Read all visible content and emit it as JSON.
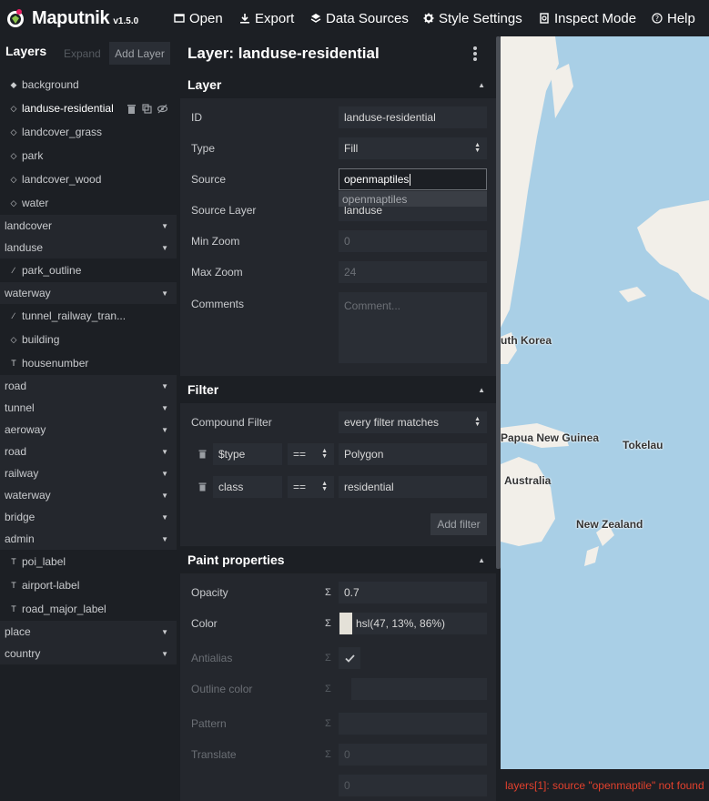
{
  "app": {
    "name": "Maputnik",
    "version": "v1.5.0"
  },
  "menu": [
    {
      "label": "Open",
      "icon": "folder-open-icon"
    },
    {
      "label": "Export",
      "icon": "download-icon"
    },
    {
      "label": "Data Sources",
      "icon": "layers-stack-icon"
    },
    {
      "label": "Style Settings",
      "icon": "gear-icon"
    },
    {
      "label": "Inspect Mode",
      "icon": "inspect-icon"
    },
    {
      "label": "Help",
      "icon": "help-circle-icon"
    }
  ],
  "layer_panel": {
    "title": "Layers",
    "expand_label": "Expand",
    "add_layer_label": "Add Layer",
    "items": [
      {
        "kind": "layer",
        "label": "background",
        "icon": "background-layer-icon"
      },
      {
        "kind": "layer",
        "label": "landuse-residential",
        "icon": "fill-layer-icon",
        "selected": true
      },
      {
        "kind": "layer",
        "label": "landcover_grass",
        "icon": "fill-layer-icon"
      },
      {
        "kind": "layer",
        "label": "park",
        "icon": "fill-layer-icon"
      },
      {
        "kind": "layer",
        "label": "landcover_wood",
        "icon": "fill-layer-icon"
      },
      {
        "kind": "layer",
        "label": "water",
        "icon": "fill-layer-icon"
      },
      {
        "kind": "group",
        "label": "landcover"
      },
      {
        "kind": "group",
        "label": "landuse"
      },
      {
        "kind": "layer",
        "label": "park_outline",
        "icon": "line-layer-icon"
      },
      {
        "kind": "group",
        "label": "waterway"
      },
      {
        "kind": "layer",
        "label": "tunnel_railway_tran...",
        "icon": "line-layer-icon"
      },
      {
        "kind": "layer",
        "label": "building",
        "icon": "fill-layer-icon"
      },
      {
        "kind": "layer",
        "label": "housenumber",
        "icon": "symbol-layer-icon"
      },
      {
        "kind": "group",
        "label": "road"
      },
      {
        "kind": "group",
        "label": "tunnel"
      },
      {
        "kind": "group",
        "label": "aeroway"
      },
      {
        "kind": "group",
        "label": "road"
      },
      {
        "kind": "group",
        "label": "railway"
      },
      {
        "kind": "group",
        "label": "waterway"
      },
      {
        "kind": "group",
        "label": "bridge"
      },
      {
        "kind": "group",
        "label": "admin"
      },
      {
        "kind": "layer",
        "label": "poi_label",
        "icon": "symbol-layer-icon"
      },
      {
        "kind": "layer",
        "label": "airport-label",
        "icon": "symbol-layer-icon"
      },
      {
        "kind": "layer",
        "label": "road_major_label",
        "icon": "symbol-layer-icon"
      },
      {
        "kind": "group",
        "label": "place"
      },
      {
        "kind": "group",
        "label": "country"
      }
    ]
  },
  "editor": {
    "title": "Layer: landuse-residential",
    "layer_section": {
      "title": "Layer",
      "id_label": "ID",
      "id_value": "landuse-residential",
      "type_label": "Type",
      "type_value": "Fill",
      "source_label": "Source",
      "source_value": "openmaptiles",
      "source_suggestion": "openmaptiles",
      "source_layer_label": "Source Layer",
      "source_layer_value": "landuse",
      "min_zoom_label": "Min Zoom",
      "min_zoom_placeholder": "0",
      "max_zoom_label": "Max Zoom",
      "max_zoom_placeholder": "24",
      "comments_label": "Comments",
      "comments_placeholder": "Comment..."
    },
    "filter_section": {
      "title": "Filter",
      "compound_label": "Compound Filter",
      "compound_value": "every filter matches",
      "rows": [
        {
          "key": "$type",
          "op": "==",
          "value": "Polygon"
        },
        {
          "key": "class",
          "op": "==",
          "value": "residential"
        }
      ],
      "add_filter_label": "Add filter"
    },
    "paint_section": {
      "title": "Paint properties",
      "opacity_label": "Opacity",
      "opacity_value": "0.7",
      "color_label": "Color",
      "color_value": "hsl(47, 13%, 86%)",
      "color_swatch": "#e4e1d8",
      "antialias_label": "Antialias",
      "outline_color_label": "Outline color",
      "pattern_label": "Pattern",
      "translate_label": "Translate",
      "translate_x_placeholder": "0",
      "translate_y_placeholder": "0",
      "sigma": "Σ"
    }
  },
  "map": {
    "labels": [
      "uth Korea",
      "Papua New Guinea",
      "Tokelau",
      "Australia",
      "New Zealand"
    ],
    "water_color": "#a9cfe6",
    "land_color": "#f2efe9"
  },
  "status": {
    "error": "layers[1]: source \"openmaptile\" not found"
  },
  "colors": {
    "bg_dark": "#1c1f24",
    "panel": "#24272d",
    "field": "#2a2e35",
    "error": "#e3412d"
  }
}
